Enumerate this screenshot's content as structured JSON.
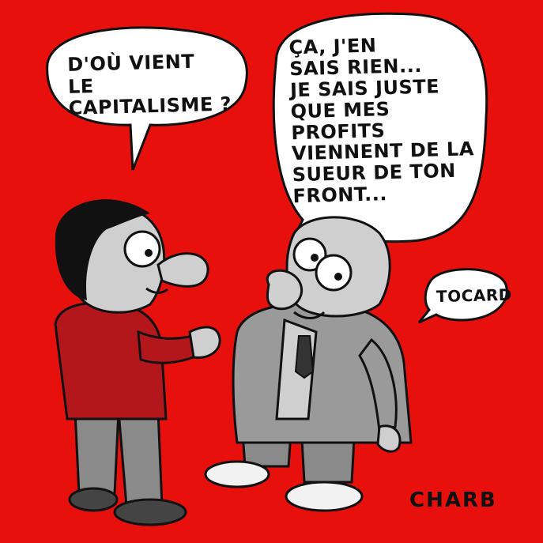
{
  "bubbles": {
    "left_question": "D'où vient\nle capitalisme ?",
    "right_answer": "Ça, j'en\nsais rien...\nje sais juste\nque mes profits\nviennent de la\nsueur de ton\nfront...",
    "aside": "Tocard"
  },
  "signature": "CHARB",
  "colors": {
    "background": "#e8100d",
    "left_character_shirt": "#b3171b",
    "right_character_suit": "#9a9a9a",
    "ink": "#111111"
  }
}
